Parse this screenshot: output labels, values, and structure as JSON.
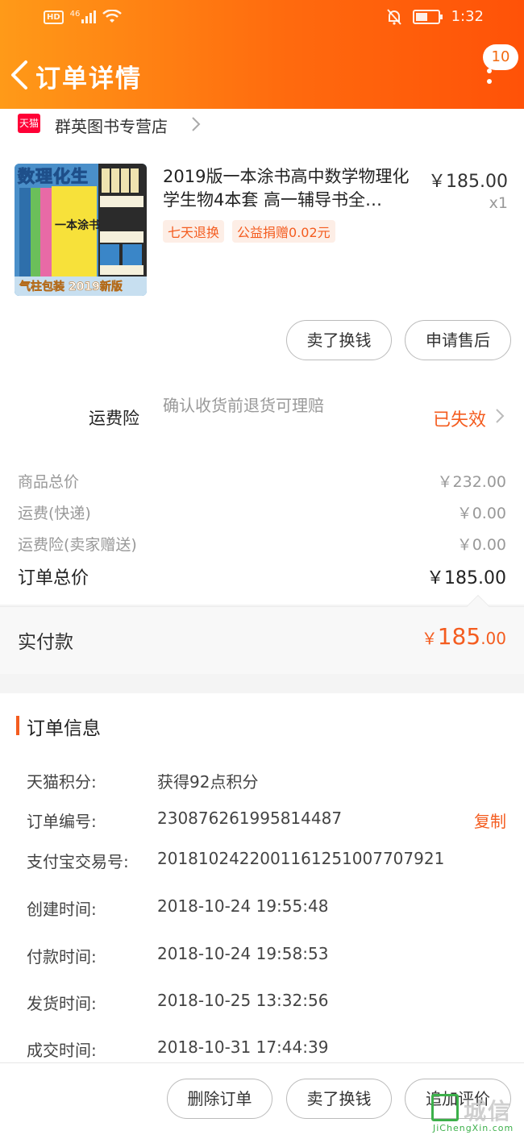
{
  "status_bar": {
    "hd": "HD",
    "network": "46",
    "time": "1:32"
  },
  "nav": {
    "title": "订单详情",
    "message_count": "10"
  },
  "shop": {
    "badge": "天猫",
    "name": "群英图书专营店"
  },
  "product": {
    "title": "2019版一本涂书高中数学物理化学生物4本套 高一辅导书全…",
    "price": "￥185.00",
    "quantity": "x1",
    "tags": [
      "七天退换",
      "公益捐赠0.02元"
    ],
    "thumb_text_top": "数理化生",
    "thumb_text_center": "一本涂书",
    "thumb_text_bottom": "气柱包装 2019新版",
    "sell_button": "卖了换钱",
    "after_sale_button": "申请售后"
  },
  "insurance": {
    "label": "运费险",
    "desc": "确认收货前退货可理赔",
    "status": "已失效"
  },
  "summary": {
    "rows": [
      {
        "label": "商品总价",
        "value": "￥232.00"
      },
      {
        "label": "运费(快递)",
        "value": "￥0.00"
      },
      {
        "label": "运费险(卖家赠送)",
        "value": "￥0.00"
      }
    ],
    "total_label": "订单总价",
    "total_value": "￥185.00"
  },
  "paid": {
    "label": "实付款",
    "currency": "￥",
    "integer": "185",
    "decimal": ".00"
  },
  "order_info": {
    "title": "订单信息",
    "rows": [
      {
        "key": "天猫积分:",
        "value": "获得92点积分"
      },
      {
        "key": "订单编号:",
        "value": "230876261995814487",
        "action": "复制"
      },
      {
        "key": "支付宝交易号:",
        "value": "2018102422001161251007707921"
      },
      {
        "key": "创建时间:",
        "value": "2018-10-24 19:55:48"
      },
      {
        "key": "付款时间:",
        "value": "2018-10-24 19:58:53"
      },
      {
        "key": "发货时间:",
        "value": "2018-10-25 13:32:56"
      },
      {
        "key": "成交时间:",
        "value": "2018-10-31 17:44:39"
      }
    ]
  },
  "bottom_bar": {
    "delete": "删除订单",
    "sell": "卖了换钱",
    "review": "追加评价"
  },
  "watermark": {
    "text": "城信",
    "url": "JiChengXin.com"
  },
  "colors": {
    "header_start": "#ff9a18",
    "header_end": "#ff5208",
    "accent": "#f45c1f",
    "tmall_red": "#ff0036"
  }
}
